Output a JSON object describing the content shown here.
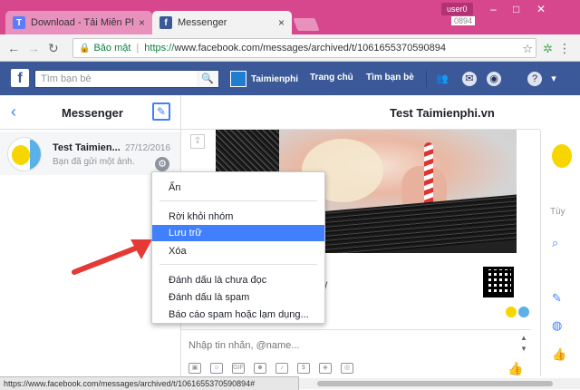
{
  "browser": {
    "tabs": [
      {
        "label": "Download - Tải Miễn Phí",
        "icon": "T"
      },
      {
        "label": "Messenger",
        "icon": "f"
      }
    ],
    "profile": "user0",
    "address": {
      "secure_label": "Bảo mật",
      "url_scheme": "https://",
      "url_rest": "www.facebook.com/messages/archived/t/1061655370590894"
    },
    "ghost_text": "0894"
  },
  "facebook": {
    "search_placeholder": "Tìm bạn bè",
    "profile_name": "Taimienphi",
    "nav": [
      "Trang chủ",
      "Tìm bạn bè"
    ]
  },
  "sidebar": {
    "title": "Messenger",
    "conversation": {
      "name": "Test Taimien...",
      "date": "27/12/2016",
      "preview": "Bạn đã gửi một ảnh."
    }
  },
  "chat": {
    "title": "Test Taimienphi.vn",
    "input_placeholder": "Nhập tin nhắn, @name...",
    "tools": [
      "photo",
      "sticker",
      "GIF",
      "emoji",
      "mic",
      "money",
      "game",
      "camera"
    ]
  },
  "right_panel": {
    "text": "Tùy"
  },
  "context_menu": {
    "items": [
      "Ẩn",
      "Rời khỏi nhóm",
      "Lưu trữ",
      "Xóa",
      "Đánh dấu là chưa đọc",
      "Đánh dấu là spam",
      "Báo cáo spam hoặc lạm dụng..."
    ],
    "highlighted": "Lưu trữ"
  },
  "status_bar": "https://www.facebook.com/messages/archived/t/1061655370590894#",
  "colors": {
    "fb_blue": "#3b5998",
    "chrome_pink": "#d6478e",
    "highlight": "#4080ff",
    "arrow": "#e53935"
  }
}
